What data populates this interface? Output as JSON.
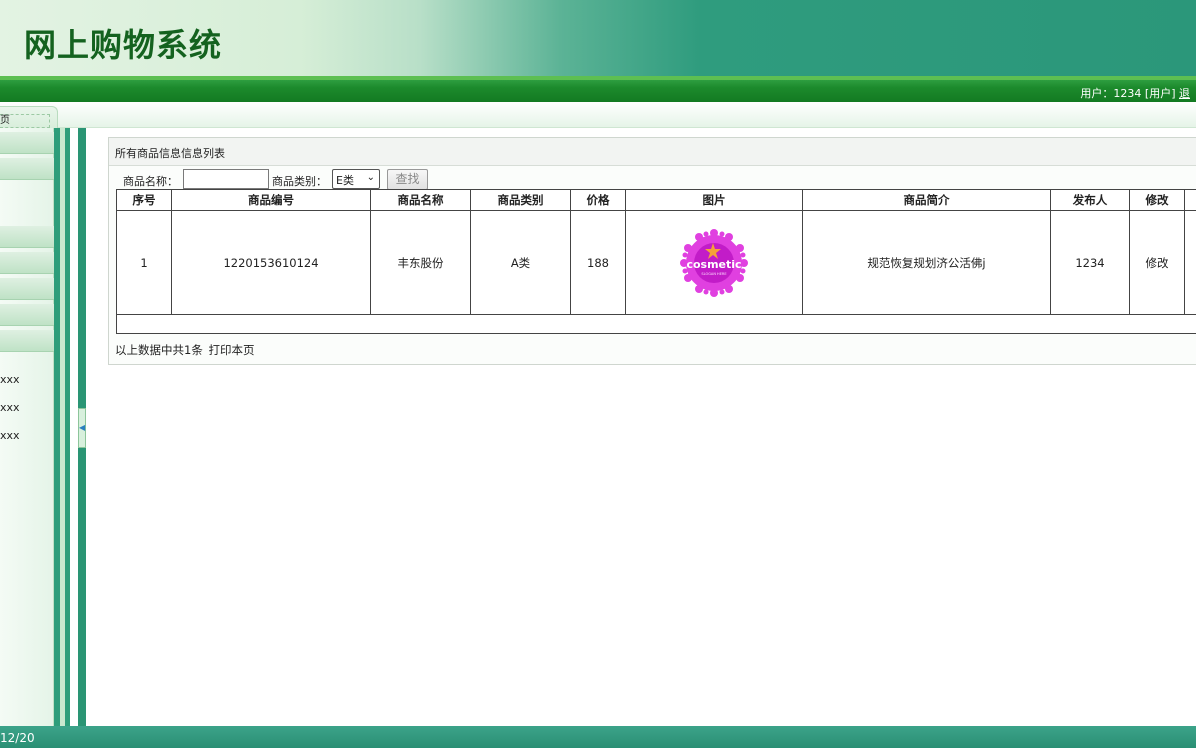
{
  "app": {
    "title": "网上购物系统"
  },
  "topbar": {
    "user_text": "用户：1234 [用户]",
    "logout": "退"
  },
  "tab": {
    "label": "页"
  },
  "sidebar": {
    "items": [
      {
        "label": "xxx"
      },
      {
        "label": "xxx"
      },
      {
        "label": "xxx"
      }
    ]
  },
  "panel": {
    "title": "所有商品信息信息列表",
    "search": {
      "name_label": "商品名称：",
      "name_value": "",
      "category_label": "商品类别：",
      "category_value": "E类",
      "button": "查找"
    },
    "table": {
      "headers": [
        "序号",
        "商品编号",
        "商品名称",
        "商品类别",
        "价格",
        "图片",
        "商品简介",
        "发布人",
        "修改"
      ],
      "rows": [
        {
          "index": "1",
          "code": "1220153610124",
          "name": "丰东股份",
          "category": "A类",
          "price": "188",
          "image_icon": "cosmetic-logo",
          "intro": "规范恢复规划济公活佛j",
          "publisher": "1234",
          "edit": "修改"
        }
      ]
    },
    "footer": {
      "summary": "以上数据中共1条",
      "print": "打印本页"
    }
  },
  "statusbar": {
    "text": "12/20"
  },
  "colors": {
    "header_green": "#14621f",
    "bar_green": "#1c8a2c",
    "teal": "#2e9d7a",
    "logo_magenta": "#d62ad6"
  }
}
